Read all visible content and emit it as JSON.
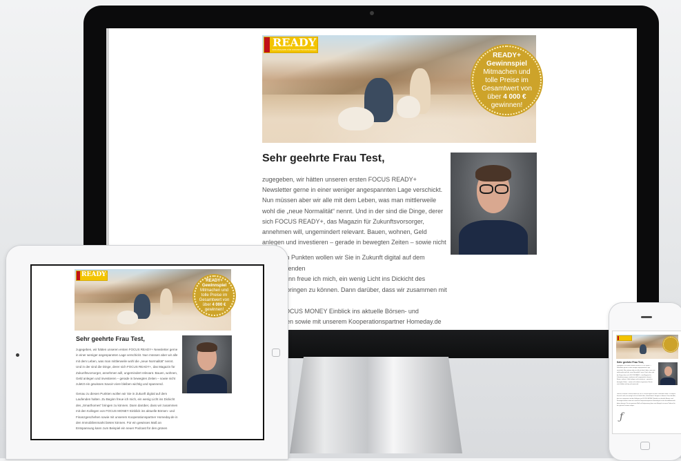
{
  "email": {
    "logo_text": "READY+",
    "logo_sub": "DAS MAGAZIN FÜR ZUKUNFTSVORSORGER",
    "badge": {
      "line1": "READY+",
      "line2": "Gewinnspiel",
      "line3": "Mitmachen und",
      "line4": "tolle Preise im",
      "line5": "Gesamtwert von",
      "line6_pre": "über ",
      "line6_bold": "4 000 €",
      "line7": "gewinnen!"
    },
    "greeting": "Sehr geehrte Frau Test,",
    "paragraph1": "zugegeben, wir hätten unseren ersten FOCUS READY+ Newsletter gerne in einer weniger angespannten Lage verschickt. Nun müssen aber wir alle mit dem Leben, was man mittlerweile wohl die „neue Normalität“ nennt. Und in der sind die Dinge, derer sich FOCUS READY+, das Magazin für Zukunftsvorsorger, annehmen will, ungemindert relevant. Bauen, wohnen, Geld anlegen und investieren – gerade in bewegten Zeiten – sowie nicht zuletzt ein gewisses Savoir-vivre bleiben wichtig und spannend.",
    "paragraph2": "Genau zu diesen Punkten wollen wir Sie in Zukunft digital auf dem Laufenden halten. Zu Beginn freue ich mich, ein wenig Licht ins Dickicht des „Smarthomes“ bringen zu können. Dann darüber, dass wir zusammen mit den Kollegen von FOCUS MONEY Einblick ins aktuelle Börsen- und Finanzgeschehen sowie mit unserem Kooperationspartner Homeday.de in den Immobilienmarkt bieten können. Für ein gewisses Maß an Entspannung kann zum Beispiel ein neuer Podcast für den grünen Daumen sorgen.",
    "paragraph2_partial": "esen Punkten wollen wir Sie in Zukunft digital auf dem Laufenden\nBeginn freue ich mich, ein wenig Licht ins Dickicht des\nes“ bringen zu können. Dann darüber, dass wir zusammen mit den\nn FOCUS MONEY Einblick ins aktuelle Börsen- und\nhehen sowie mit unserem Kooperationspartner Homeday.de in\nilienmarkt bieten können. Für ein gewisses Maß an Entspannung\neispiel ein neuer Podcast für den grünen Daumen sorgen."
  },
  "colors": {
    "logo_yellow": "#f3c400",
    "badge_gold": "#cda32a",
    "text_gray": "#555555",
    "monitor_black": "#0b0b0c"
  },
  "icons": [
    "camera-icon",
    "home-button-icon",
    "speaker-icon"
  ]
}
